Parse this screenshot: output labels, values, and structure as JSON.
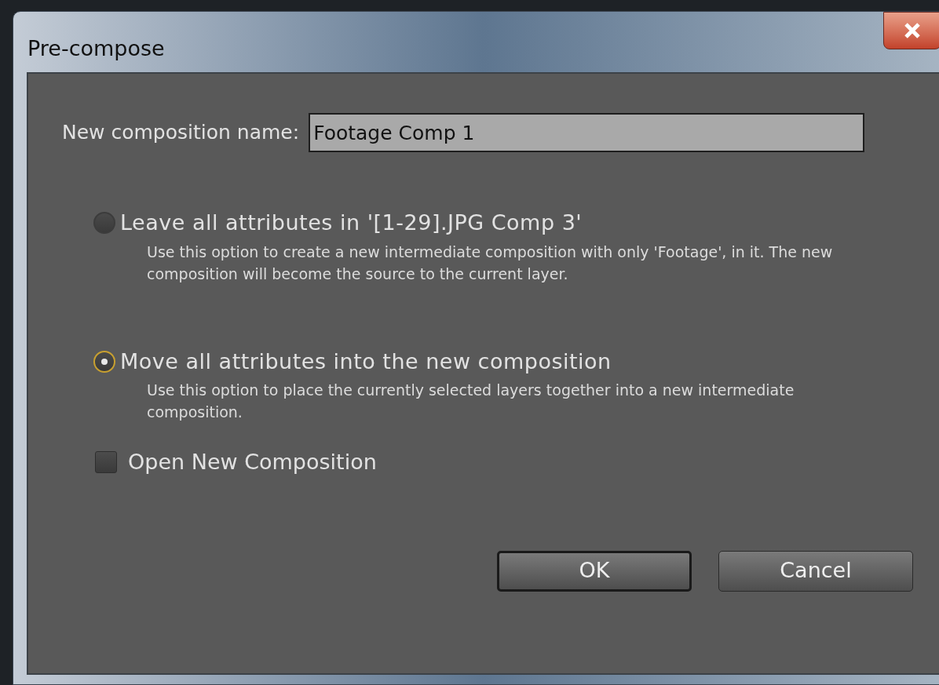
{
  "window": {
    "title": "Pre-compose"
  },
  "name_field": {
    "label": "New composition name:",
    "value": "Footage Comp 1"
  },
  "options": [
    {
      "kind": "radio",
      "label": "Leave all attributes in '[1-29].JPG Comp 3'",
      "description": "Use this option to create a new intermediate composition with only 'Footage', in it. The new composition will become the source to the current layer.",
      "selected": false
    },
    {
      "kind": "radio",
      "label": "Move all attributes into the new composition",
      "description": "Use this option to place the currently selected layers together into a new intermediate composition.",
      "selected": true
    },
    {
      "kind": "checkbox",
      "label": "Open New Composition",
      "checked": false
    }
  ],
  "buttons": [
    {
      "label": "OK",
      "default": true
    },
    {
      "label": "Cancel",
      "default": false
    }
  ]
}
